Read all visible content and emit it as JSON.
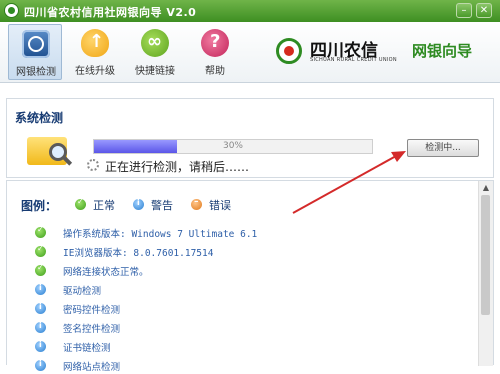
{
  "window": {
    "title": "四川省农村信用社网银向导 V2.0",
    "min_glyph": "–",
    "close_glyph": "✕"
  },
  "toolbar": {
    "items": [
      {
        "label": "网银检测",
        "icon": "shield-icon"
      },
      {
        "label": "在线升级",
        "icon": "cloud-upload-icon"
      },
      {
        "label": "快捷链接",
        "icon": "link-icon"
      },
      {
        "label": "帮助",
        "icon": "help-icon"
      }
    ]
  },
  "brand": {
    "name_cn": "四川农信",
    "name_en": "SICHUAN RURAL CREDIT UNION",
    "tagline": "网银向导"
  },
  "check": {
    "section_title": "系统检测",
    "progress_percent": 30,
    "progress_text": "30%",
    "status_text": "正在进行检测，请稍后……",
    "button_label": "检测中..."
  },
  "legend": {
    "label": "图例：",
    "ok": "正常",
    "warn": "警告",
    "error": "错误"
  },
  "results": [
    {
      "status": "ok",
      "text": "操作系统版本: Windows 7 Ultimate 6.1"
    },
    {
      "status": "ok",
      "text": "IE浏览器版本: 8.0.7601.17514"
    },
    {
      "status": "ok",
      "text": "网络连接状态正常。"
    },
    {
      "status": "warn",
      "text": "驱动检测"
    },
    {
      "status": "warn",
      "text": "密码控件检测"
    },
    {
      "status": "warn",
      "text": "签名控件检测"
    },
    {
      "status": "warn",
      "text": "证书链检测"
    },
    {
      "status": "warn",
      "text": "网络站点检测"
    }
  ],
  "colors": {
    "title_green": "#3e8f22",
    "brand_green": "#2e8b22",
    "progress_fill": "#5b56e8",
    "annotation_arrow": "#d42a2a"
  }
}
